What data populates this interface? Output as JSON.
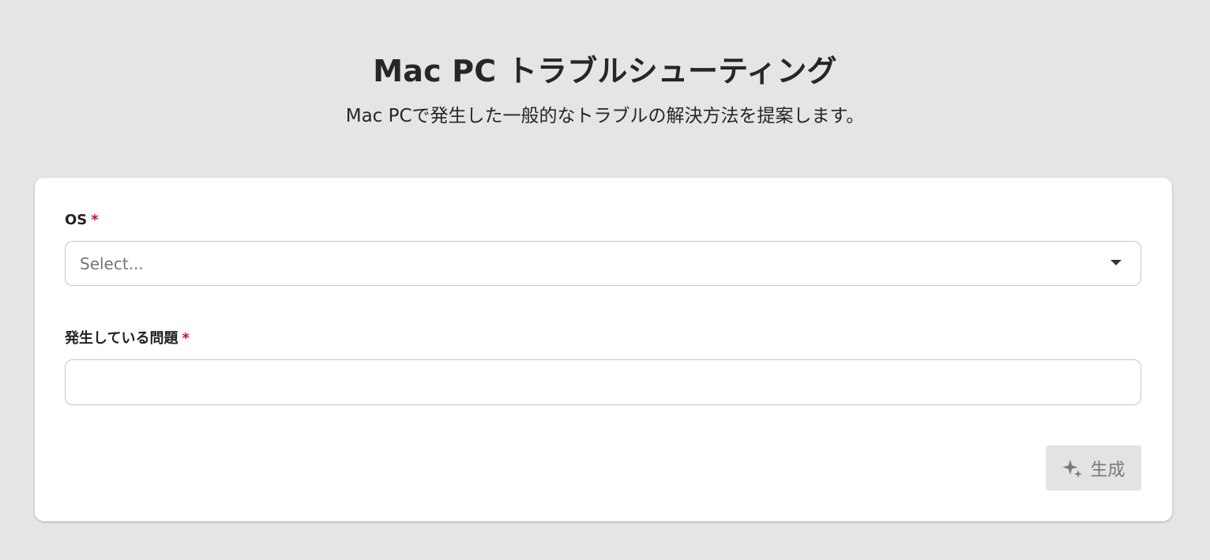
{
  "header": {
    "title": "Mac PC トラブルシューティング",
    "subtitle": "Mac PCで発生した一般的なトラブルの解決方法を提案します。"
  },
  "form": {
    "os": {
      "label": "OS",
      "required_mark": "*",
      "placeholder": "Select...",
      "icon": "chevron-down-icon"
    },
    "problem": {
      "label": "発生している問題",
      "required_mark": "*",
      "value": ""
    },
    "generate_button": {
      "label": "生成",
      "icon": "sparkle-icon",
      "disabled": true
    }
  },
  "colors": {
    "background": "#e5e5e5",
    "card": "#ffffff",
    "required": "#c8102e",
    "button_disabled_bg": "#e3e3e3",
    "button_disabled_text": "#7a7a7a"
  }
}
